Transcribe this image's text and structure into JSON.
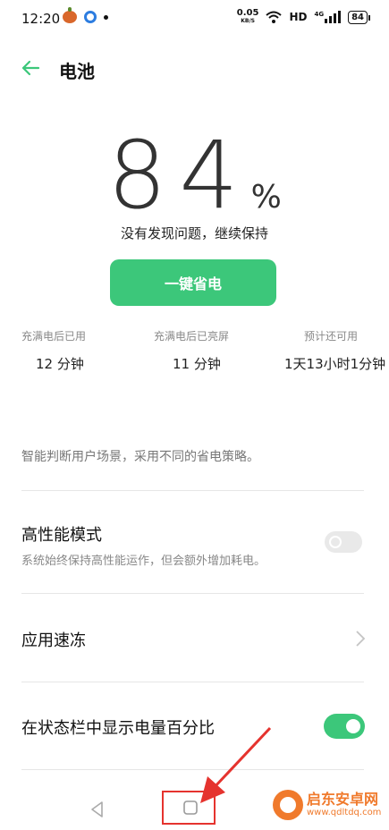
{
  "status_bar": {
    "time": "12:20",
    "net_speed_value": "0.05",
    "net_speed_unit": "KB/S",
    "hd": "HD",
    "net_type": "4G",
    "battery_level": "84"
  },
  "header": {
    "title": "电池"
  },
  "battery": {
    "percent_value": "84",
    "percent_sign": "%",
    "status_message": "没有发现问题，继续保持"
  },
  "save_button": {
    "label": "一键省电"
  },
  "stats": [
    {
      "label": "充满电后已用",
      "value": "12 分钟"
    },
    {
      "label": "充满电后已亮屏",
      "value": "11 分钟"
    },
    {
      "label": "预计还可用",
      "value": "1天13小时1分钟"
    }
  ],
  "hint": "智能判断用户场景，采用不同的省电策略。",
  "settings": {
    "performance_mode": {
      "title": "高性能模式",
      "subtitle": "系统始终保持高性能运作，但会额外增加耗电。",
      "enabled": false
    },
    "app_freeze": {
      "title": "应用速冻"
    },
    "show_percentage": {
      "title": "在状态栏中显示电量百分比",
      "enabled": true
    }
  },
  "watermark": {
    "name": "启东安卓网",
    "url": "www.qdltdq.com"
  },
  "colors": {
    "accent": "#3cc77a",
    "annotation": "#e5332e",
    "watermark": "#f07a2c"
  }
}
